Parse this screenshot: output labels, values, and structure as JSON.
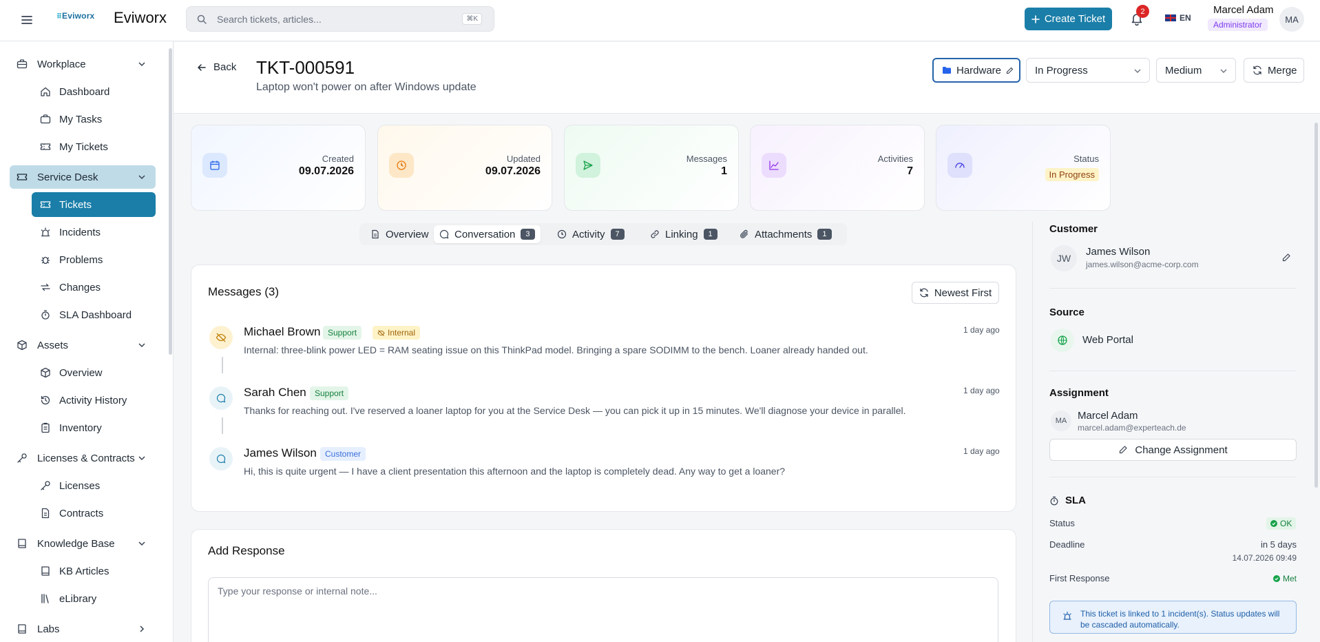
{
  "app": {
    "logo_text": "Eviworx",
    "title": "Eviworx"
  },
  "search": {
    "placeholder": "Search tickets, articles...",
    "shortcut": "⌘K"
  },
  "topbar": {
    "create_label": "Create Ticket",
    "notifications": "2",
    "language": "EN",
    "user_name": "Marcel Adam",
    "user_role": "Administrator",
    "user_initials": "MA"
  },
  "sidebar": {
    "groups": [
      {
        "label": "Workplace",
        "icon": "briefcase-icon"
      },
      {
        "label": "Service Desk",
        "icon": "ticket-icon"
      },
      {
        "label": "Assets",
        "icon": "box-icon"
      },
      {
        "label": "Licenses & Contracts",
        "icon": "key-icon"
      },
      {
        "label": "Knowledge Base",
        "icon": "book-icon"
      },
      {
        "label": "Labs",
        "icon": "flask-icon"
      }
    ],
    "items": [
      {
        "label": "Dashboard",
        "icon": "home-icon"
      },
      {
        "label": "My Tasks",
        "icon": "briefcase-icon"
      },
      {
        "label": "My Tickets",
        "icon": "ticket-icon"
      },
      {
        "label": "Tickets",
        "icon": "ticket-icon"
      },
      {
        "label": "Incidents",
        "icon": "siren-icon"
      },
      {
        "label": "Problems",
        "icon": "bug-icon"
      },
      {
        "label": "Changes",
        "icon": "repeat-icon"
      },
      {
        "label": "SLA Dashboard",
        "icon": "timer-icon"
      },
      {
        "label": "Overview",
        "icon": "box-icon"
      },
      {
        "label": "Activity History",
        "icon": "history-icon"
      },
      {
        "label": "Inventory",
        "icon": "clipboard-icon"
      },
      {
        "label": "Licenses",
        "icon": "key-icon"
      },
      {
        "label": "Contracts",
        "icon": "file-icon"
      },
      {
        "label": "KB Articles",
        "icon": "book-icon"
      },
      {
        "label": "eLibrary",
        "icon": "library-icon"
      }
    ]
  },
  "ticket": {
    "back_label": "Back",
    "id": "TKT-000591",
    "subject": "Laptop won't power on after Windows update",
    "category": "Hardware",
    "status": "In Progress",
    "priority": "Medium",
    "merge_label": "Merge"
  },
  "stats": [
    {
      "label": "Created",
      "value": "09.07.2026",
      "icon": "calendar-icon"
    },
    {
      "label": "Updated",
      "value": "09.07.2026",
      "icon": "clock-icon"
    },
    {
      "label": "Messages",
      "value": "1",
      "icon": "send-icon"
    },
    {
      "label": "Activities",
      "value": "7",
      "icon": "chart-icon"
    },
    {
      "label": "Status",
      "value": "In Progress",
      "icon": "gauge-icon"
    }
  ],
  "tabs": [
    {
      "label": "Overview",
      "count": ""
    },
    {
      "label": "Conversation",
      "count": "3"
    },
    {
      "label": "Activity",
      "count": "7"
    },
    {
      "label": "Linking",
      "count": "1"
    },
    {
      "label": "Attachments",
      "count": "1"
    }
  ],
  "messages_panel": {
    "title": "Messages (3)",
    "sort_label": "Newest First",
    "messages": [
      {
        "author": "Michael Brown",
        "role": "Support",
        "internal": "Internal",
        "time": "1 day ago",
        "text": "Internal: three-blink power LED = RAM seating issue on this ThinkPad model. Bringing a spare SODIMM to the bench. Loaner already handed out."
      },
      {
        "author": "Sarah Chen",
        "role": "Support",
        "time": "1 day ago",
        "text": "Thanks for reaching out. I've reserved a loaner laptop for you at the Service Desk — you can pick it up in 15 minutes. We'll diagnose your device in parallel."
      },
      {
        "author": "James Wilson",
        "role": "Customer",
        "time": "1 day ago",
        "text": "Hi, this is quite urgent — I have a client presentation this afternoon and the laptop is completely dead. Any way to get a loaner?"
      }
    ]
  },
  "response": {
    "title": "Add Response",
    "placeholder": "Type your response or internal note..."
  },
  "details": {
    "customer_title": "Customer",
    "customer_initials": "JW",
    "customer_name": "James Wilson",
    "customer_email": "james.wilson@acme-corp.com",
    "source_title": "Source",
    "source_value": "Web Portal",
    "assignment_title": "Assignment",
    "assignee_initials": "MA",
    "assignee_name": "Marcel Adam",
    "assignee_email": "marcel.adam@experteach.de",
    "change_assignment_label": "Change Assignment",
    "sla_title": "SLA",
    "sla_status_label": "Status",
    "sla_status_value": "OK",
    "sla_deadline_label": "Deadline",
    "sla_deadline_relative": "in 5 days",
    "sla_deadline_value": "14.07.2026 09:49",
    "sla_first_response_label": "First Response",
    "sla_first_response_value": "Met",
    "incident_notice": "This ticket is linked to 1 incident(s). Status updates will be cascaded automatically."
  },
  "colors": {
    "accent": "#1a7ea8",
    "support_badge": "#e3f5e8",
    "internal_badge": "#fdf3c7",
    "customer_badge": "#e6efff"
  }
}
